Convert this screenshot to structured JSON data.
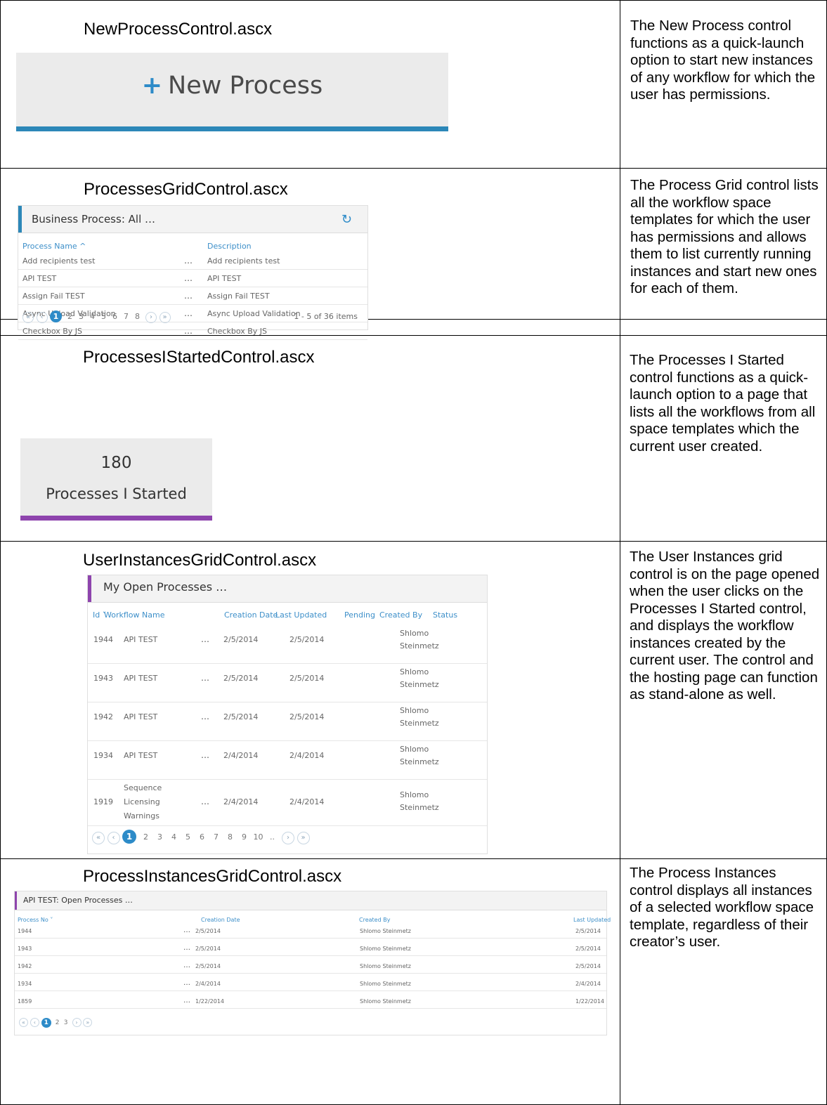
{
  "rows": {
    "new_process": {
      "heading": "NewProcessControl.ascx",
      "button_plus": "+",
      "button_label": "New Process",
      "description": "The New Process control functions as a quick-launch option to start new instances of any workflow for which the user has permissions."
    },
    "processes_grid": {
      "heading": "ProcessesGridControl.ascx",
      "title": "Business Process: All",
      "more": "…",
      "refresh_icon": "refresh-icon",
      "columns": [
        "Process Name ^",
        "Description"
      ],
      "items": [
        {
          "name": "Add recipients test",
          "description": "Add recipients test"
        },
        {
          "name": "API TEST",
          "description": "API TEST"
        },
        {
          "name": "Assign Fail TEST",
          "description": "Assign Fail TEST"
        },
        {
          "name": "Async Upload Validation",
          "description": "Async Upload Validation"
        },
        {
          "name": "Checkbox By JS",
          "description": "Checkbox By JS"
        }
      ],
      "pager": {
        "current": "1",
        "pages": [
          "2",
          "3",
          "4",
          "5",
          "6",
          "7",
          "8"
        ],
        "summary": "1 - 5 of 36 items"
      },
      "description": "The Process Grid control lists all the workflow space templates for which the user has permissions and allows them to list currently running instances and start new ones for each of them."
    },
    "processes_i_started": {
      "heading": "ProcessesIStartedControl.ascx",
      "count": "180",
      "label": "Processes I Started",
      "description": "The Processes I Started control functions as a quick-launch option to a page that lists all the workflows from all space templates which the current user created."
    },
    "user_instances": {
      "heading": "UserInstancesGridControl.ascx",
      "title": "My Open Processes",
      "more": "…",
      "columns": [
        "Id ˅",
        "Workflow Name",
        "Creation Date",
        "Last Updated",
        "Pending",
        "Created By",
        "Status"
      ],
      "items": [
        {
          "id": "1944",
          "workflow": [
            "API TEST"
          ],
          "created": "2/5/2014",
          "updated": "2/5/2014",
          "by": [
            "Shlomo",
            "Steinmetz"
          ]
        },
        {
          "id": "1943",
          "workflow": [
            "API TEST"
          ],
          "created": "2/5/2014",
          "updated": "2/5/2014",
          "by": [
            "Shlomo",
            "Steinmetz"
          ]
        },
        {
          "id": "1942",
          "workflow": [
            "API TEST"
          ],
          "created": "2/5/2014",
          "updated": "2/5/2014",
          "by": [
            "Shlomo",
            "Steinmetz"
          ]
        },
        {
          "id": "1934",
          "workflow": [
            "API TEST"
          ],
          "created": "2/4/2014",
          "updated": "2/4/2014",
          "by": [
            "Shlomo",
            "Steinmetz"
          ]
        },
        {
          "id": "1919",
          "workflow": [
            "Sequence",
            "Licensing",
            "Warnings"
          ],
          "created": "2/4/2014",
          "updated": "2/4/2014",
          "by": [
            "Shlomo",
            "Steinmetz"
          ]
        }
      ],
      "pager": {
        "current": "1",
        "pages": [
          "2",
          "3",
          "4",
          "5",
          "6",
          "7",
          "8",
          "9",
          "10",
          ".."
        ]
      },
      "description": "The User Instances grid control is on the page opened when the user clicks on the Processes I Started control, and displays the workflow instances created by the current user. The control and the hosting page can function as stand-alone as well."
    },
    "process_instances": {
      "heading": "ProcessInstancesGridControl.ascx",
      "title": "API TEST: Open Processes",
      "more": "…",
      "columns": [
        "Process No ˅",
        "Creation Date",
        "Created By",
        "Last Updated"
      ],
      "items": [
        {
          "no": "1944",
          "created": "2/5/2014",
          "by": "Shlomo Steinmetz",
          "updated": "2/5/2014"
        },
        {
          "no": "1943",
          "created": "2/5/2014",
          "by": "Shlomo Steinmetz",
          "updated": "2/5/2014"
        },
        {
          "no": "1942",
          "created": "2/5/2014",
          "by": "Shlomo Steinmetz",
          "updated": "2/5/2014"
        },
        {
          "no": "1934",
          "created": "2/4/2014",
          "by": "Shlomo Steinmetz",
          "updated": "2/4/2014"
        },
        {
          "no": "1859",
          "created": "1/22/2014",
          "by": "Shlomo Steinmetz",
          "updated": "1/22/2014"
        }
      ],
      "pager": {
        "current": "1",
        "pages": [
          "2",
          "3"
        ]
      },
      "description": "The Process Instances control displays all instances of a selected workflow space template, regardless of their creator’s user."
    }
  },
  "pager_icons": {
    "first": "«",
    "prev": "‹",
    "next": "›",
    "last": "»"
  },
  "colors": {
    "accent_blue": "#2d8bc8",
    "accent_purple": "#8e44ad",
    "header_blue": "#3d8fc9"
  }
}
